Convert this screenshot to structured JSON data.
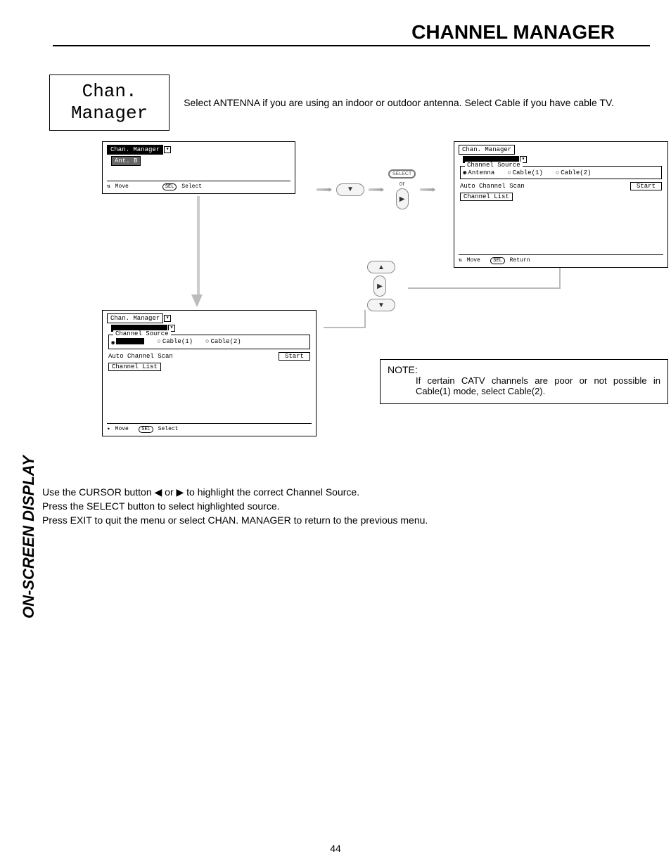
{
  "page_title": "CHANNEL MANAGER",
  "topic_box": "Chan.\nManager",
  "topic_desc": "Select ANTENNA if you are using an indoor or outdoor antenna.  Select Cable if you have cable TV.",
  "panel1": {
    "crumb": "Chan. Manager",
    "row": "Ant. B",
    "footer_move": "Move",
    "footer_sel_btn": "SEL",
    "footer_sel": "Select"
  },
  "select_label": "SELECT",
  "or_label": "or",
  "panel2": {
    "crumb": "Chan. Manager",
    "fs_label": "Channel Source",
    "src_ant": "Antenna",
    "src_c1": "Cable(1)",
    "src_c2": "Cable(2)",
    "auto": "Auto Channel Scan",
    "start": "Start",
    "chlist": "Channel List",
    "footer_move": "Move",
    "footer_ret_btn": "SEL",
    "footer_ret": "Return"
  },
  "panel3": {
    "crumb": "Chan. Manager",
    "fs_label": "Channel Source",
    "src_c1": "Cable(1)",
    "src_c2": "Cable(2)",
    "auto": "Auto Channel Scan",
    "start": "Start",
    "chlist": "Channel List",
    "footer_move": "Move",
    "footer_sel_btn": "SEL",
    "footer_sel": "Select"
  },
  "note_title": "NOTE:",
  "note_text": "If certain CATV channels are poor or not possible in Cable(1) mode, select Cable(2).",
  "instr1": "Use the CURSOR button ◀ or ▶ to highlight the correct Channel Source.",
  "instr2": "Press the SELECT button to select highlighted source.",
  "instr3": "Press EXIT to quit the menu or select CHAN. MANAGER to return to the previous menu.",
  "side_label": "ON-SCREEN DISPLAY",
  "page_number": "44"
}
